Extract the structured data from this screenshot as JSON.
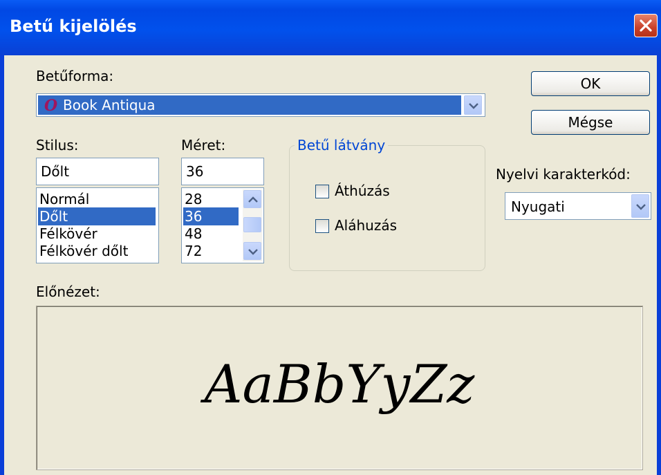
{
  "window": {
    "title": "Betű kijelölés"
  },
  "font": {
    "label": "Betűforma:",
    "selected": "Book Antiqua",
    "icon": "opentype-font-icon"
  },
  "style": {
    "label": "Stilus:",
    "value": "Dőlt",
    "items": [
      "Normál",
      "Dőlt",
      "Félkövér",
      "Félkövér dőlt"
    ],
    "selected_index": 1
  },
  "size": {
    "label": "Méret:",
    "value": "36",
    "items": [
      "28",
      "36",
      "48",
      "72"
    ],
    "selected_index": 1
  },
  "effects": {
    "label": "Betű látvány",
    "strikeout_label": "Áthúzás",
    "underline_label": "Aláhuzás",
    "strikeout_checked": false,
    "underline_checked": false
  },
  "buttons": {
    "ok": "OK",
    "cancel": "Mégse"
  },
  "charset": {
    "label": "Nyelvi karakterkód:",
    "selected": "Nyugati"
  },
  "preview": {
    "label": "Előnézet:",
    "sample": "AaBbYyZz"
  },
  "colors": {
    "title_bar": "#0148e4",
    "dialog_bg": "#ece9d8",
    "selection": "#316ac5",
    "group_label": "#0046d5"
  }
}
